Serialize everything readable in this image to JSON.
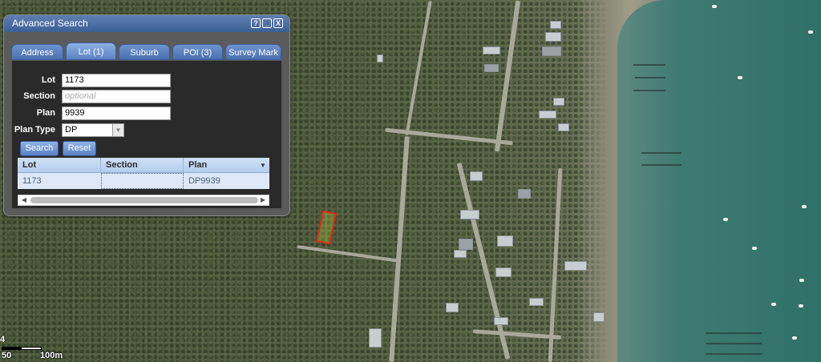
{
  "panel": {
    "title": "Advanced Search",
    "title_buttons": [
      {
        "name": "help-button",
        "glyph": "?"
      },
      {
        "name": "minimize-button",
        "glyph": "_"
      },
      {
        "name": "close-button",
        "glyph": "X"
      }
    ]
  },
  "tabs": [
    {
      "label": "Address",
      "active": false
    },
    {
      "label": "Lot (1)",
      "active": true
    },
    {
      "label": "Suburb",
      "active": false
    },
    {
      "label": "POI (3)",
      "active": false
    },
    {
      "label": "Survey Mark",
      "active": false
    }
  ],
  "form": {
    "lot": {
      "label": "Lot",
      "value": "1173"
    },
    "section": {
      "label": "Section",
      "value": "",
      "placeholder": "optional"
    },
    "plan": {
      "label": "Plan",
      "value": "9939"
    },
    "plan_type": {
      "label": "Plan Type",
      "value": "DP"
    },
    "search_label": "Search",
    "reset_label": "Reset"
  },
  "results": {
    "columns": [
      "Lot",
      "Section",
      "Plan"
    ],
    "rows": [
      {
        "lot": "1173",
        "section": "",
        "plan": "DP9939"
      }
    ]
  },
  "scale": {
    "top_label": "4",
    "left_label": "50",
    "right_label": "100m"
  },
  "colors": {
    "title_bar": "#3c5f94",
    "tab": "#4a70b0",
    "highlight": "#e02818",
    "water": "#3f7a72"
  }
}
